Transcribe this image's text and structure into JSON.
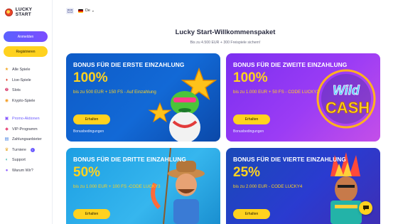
{
  "brand": {
    "name": "LUCKY START"
  },
  "auth": {
    "login_label": "Anmelden",
    "register_label": "Registrieren"
  },
  "nav": {
    "items": [
      {
        "label": "Alle Spiele",
        "icon": "star-icon"
      },
      {
        "label": "Live-Spiele",
        "icon": "live-icon"
      },
      {
        "label": "Slots",
        "icon": "slots-icon"
      },
      {
        "label": "Krypto-Spiele",
        "icon": "crypto-icon"
      }
    ],
    "secondary": [
      {
        "label": "Promo-Aktionen",
        "icon": "gift-icon",
        "active": true
      },
      {
        "label": "VIP-Programm",
        "icon": "vip-icon"
      },
      {
        "label": "Zahlungsanbieter",
        "icon": "payment-icon"
      },
      {
        "label": "Turniere",
        "icon": "trophy-icon",
        "badge": "i"
      },
      {
        "label": "Support",
        "icon": "support-icon"
      },
      {
        "label": "Warum Wir?",
        "icon": "question-icon"
      }
    ]
  },
  "topbar": {
    "language": "De"
  },
  "page": {
    "title": "Lucky Start-Willkommenspaket",
    "subtitle": "Bis zu 4.500 EUR + 300 Freispiele sichern!"
  },
  "cards": [
    {
      "title": "BONUS FÜR DIE ERSTE EINZAHLUNG",
      "percent": "100%",
      "description": "bis zu 500 EUR + 150 FS - Auf Einzahlung",
      "button": "Erhalten",
      "terms": "Bonusbedingungen"
    },
    {
      "title": "BONUS FÜR DIE ZWEITE EINZAHLUNG",
      "percent": "100%",
      "description": "bis zu 1.000 EUR + 50 FS - CODE LUCKY2",
      "button": "Erhalten",
      "terms": "Bonusbedingungen",
      "art_text": "Wild Cash"
    },
    {
      "title": "BONUS FÜR DIE DRITTE EINZAHLUNG",
      "percent": "50%",
      "description": "bis zu 1.000 EUR + 100 FS -CODE LUCKY3",
      "button": "Erhalten"
    },
    {
      "title": "BONUS FÜR DIE VIERTE EINZAHLUNG",
      "percent": "25%",
      "description": "bis zu 2.000 EUR - CODE LUCKY4",
      "button": "Erhalten"
    }
  ],
  "colors": {
    "accent": "#6c5cff",
    "yellow": "#ffd21f"
  }
}
